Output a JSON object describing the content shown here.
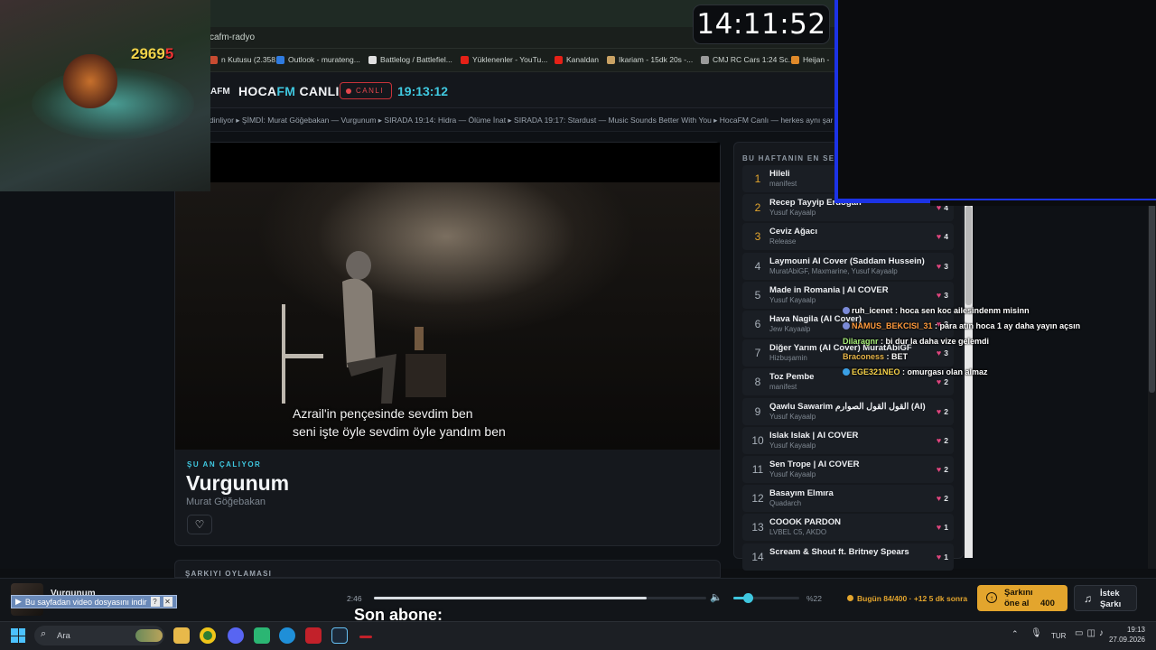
{
  "browser": {
    "url": "cafm-radyo",
    "bookmarks": [
      {
        "label": "n Kutusu (2.358...",
        "icon": "mail-icon",
        "color": "#c84b31"
      },
      {
        "label": "Outlook - murateng...",
        "icon": "outlook-icon",
        "color": "#2f7be0"
      },
      {
        "label": "Battlelog / Battlefiel...",
        "icon": "battlelog-icon",
        "color": "#e0e0e0"
      },
      {
        "label": "Yüklenenler - YouTu...",
        "icon": "youtube-icon",
        "color": "#e62117"
      },
      {
        "label": "Kanaldan",
        "icon": "youtube-icon",
        "color": "#e62117"
      },
      {
        "label": "Ikariam - 15dk 20s -...",
        "icon": "ikariam-icon",
        "color": "#c9a264"
      },
      {
        "label": "CMJ RC Cars 1:24 Sc...",
        "icon": "page-icon",
        "color": "#9a9a9a"
      },
      {
        "label": "Heijan -",
        "icon": "bookmark-icon",
        "color": "#e08a2a"
      }
    ]
  },
  "header": {
    "logo_small": "AFM",
    "title_prefix": "HOCA",
    "title_fm": "FM",
    "title_suffix": " CANLI",
    "live_label": "CANLI",
    "time": "19:13:12"
  },
  "ticker": "dinliyor ▸ ŞİMDİ: Murat Göğebakan — Vurgunum ▸ SIRADA 19:14: Hidra — Ölüme İnat ▸ SIRADA 19:17: Stardust — Music Sounds Better With You ▸ HocaFM Canlı — herkes aynı şarkıyı",
  "video": {
    "subtitle_line1": "Azrail'in pençesinde sevdim ben",
    "subtitle_line2": "seni işte öyle sevdim öyle yandım ben"
  },
  "now_playing": {
    "label": "ŞU AN ÇALIYOR",
    "title": "Vurgunum",
    "artist": "Murat Göğebakan"
  },
  "vote_section": {
    "label": "ŞARKIYI OYLAMASI"
  },
  "chart": {
    "heading": "BU HAFTANIN EN SEVİLENLERİ",
    "items": [
      {
        "rank": "1",
        "title": "Hileli",
        "artist": "manifest",
        "likes": ""
      },
      {
        "rank": "2",
        "title": "Recep Tayyip Erdoğan",
        "artist": "Yusuf Kayaalp",
        "likes": "4"
      },
      {
        "rank": "3",
        "title": "Ceviz Ağacı",
        "artist": "Release",
        "likes": "4"
      },
      {
        "rank": "4",
        "title": "Laymouni AI Cover (Saddam Hussein)",
        "artist": "MuratAbiGF, Maxmarine, Yusuf Kayaalp",
        "likes": "3"
      },
      {
        "rank": "5",
        "title": "Made in Romania | AI COVER",
        "artist": "Yusuf Kayaalp",
        "likes": "3"
      },
      {
        "rank": "6",
        "title": "Hava Nagila (AI Cover)",
        "artist": "Jew Kayaalp",
        "likes": "3"
      },
      {
        "rank": "7",
        "title": "Diğer Yarım (AI Cover) MuratAbiGF",
        "artist": "Hizbuşamin",
        "likes": "3"
      },
      {
        "rank": "8",
        "title": "Toz Pembe",
        "artist": "manifest",
        "likes": "2"
      },
      {
        "rank": "9",
        "title": "Qawlu Sawarim القول القول الصوارم (AI)",
        "artist": "Yusuf Kayaalp",
        "likes": "2"
      },
      {
        "rank": "10",
        "title": "Islak Islak | AI COVER",
        "artist": "Yusuf Kayaalp",
        "likes": "2"
      },
      {
        "rank": "11",
        "title": "Sen Trope | AI COVER",
        "artist": "Yusuf Kayaalp",
        "likes": "2"
      },
      {
        "rank": "12",
        "title": "Basayım Elmıra",
        "artist": "Quadarch",
        "likes": "2"
      },
      {
        "rank": "13",
        "title": "COOOK PARDON",
        "artist": "LVBEL C5, AKDO",
        "likes": "1"
      },
      {
        "rank": "14",
        "title": "Scream & Shout ft. Britney Spears",
        "artist": "",
        "likes": "1"
      }
    ]
  },
  "overlays": {
    "game_score": "2969",
    "game_score_red": "5",
    "clock": "14:11:52",
    "chat": [
      {
        "user": "ruh_icenet",
        "msg": " : hoca sen koc ailesindenm misinn",
        "color": "#ffffff"
      },
      {
        "user": "NAMUS_BEKCISI_31",
        "msg": " : para atın hoca 1 ay daha yayın açsın",
        "color": "#ff9a3c"
      },
      {
        "user": "Dilaragnr",
        "msg": " : bi dur la daha vize gelemdi",
        "color": "#a8f07a"
      },
      {
        "user": "Braconess",
        "msg": " : BET",
        "color": "#e8b64a"
      },
      {
        "user": "EGE321NEO",
        "msg": " : omurgası olan almaz",
        "color": "#f6d24a"
      }
    ],
    "son_abone": "Son abone:"
  },
  "player_bar": {
    "mini_title": "Vurgunum",
    "download_text": "Bu sayfadan video dosyasını indir",
    "elapsed": "2:46",
    "progress": 0.82,
    "volume": 0.22,
    "volume_label": "%22",
    "quota": "Bugün 84/400 · +12 5 dk sonra",
    "priority_line1": "Şarkını",
    "priority_line2": "öne al",
    "priority_cost": "400",
    "request_line1": "İstek",
    "request_line2": "Şarkı"
  },
  "taskbar": {
    "search_label": "Ara",
    "lang": "TUR",
    "time": "19:13",
    "date": "27.09.2026"
  },
  "colors": {
    "accent": "#3fc7df",
    "live": "#e5474d",
    "gold": "#e3a52d",
    "heart": "#e0457e"
  }
}
